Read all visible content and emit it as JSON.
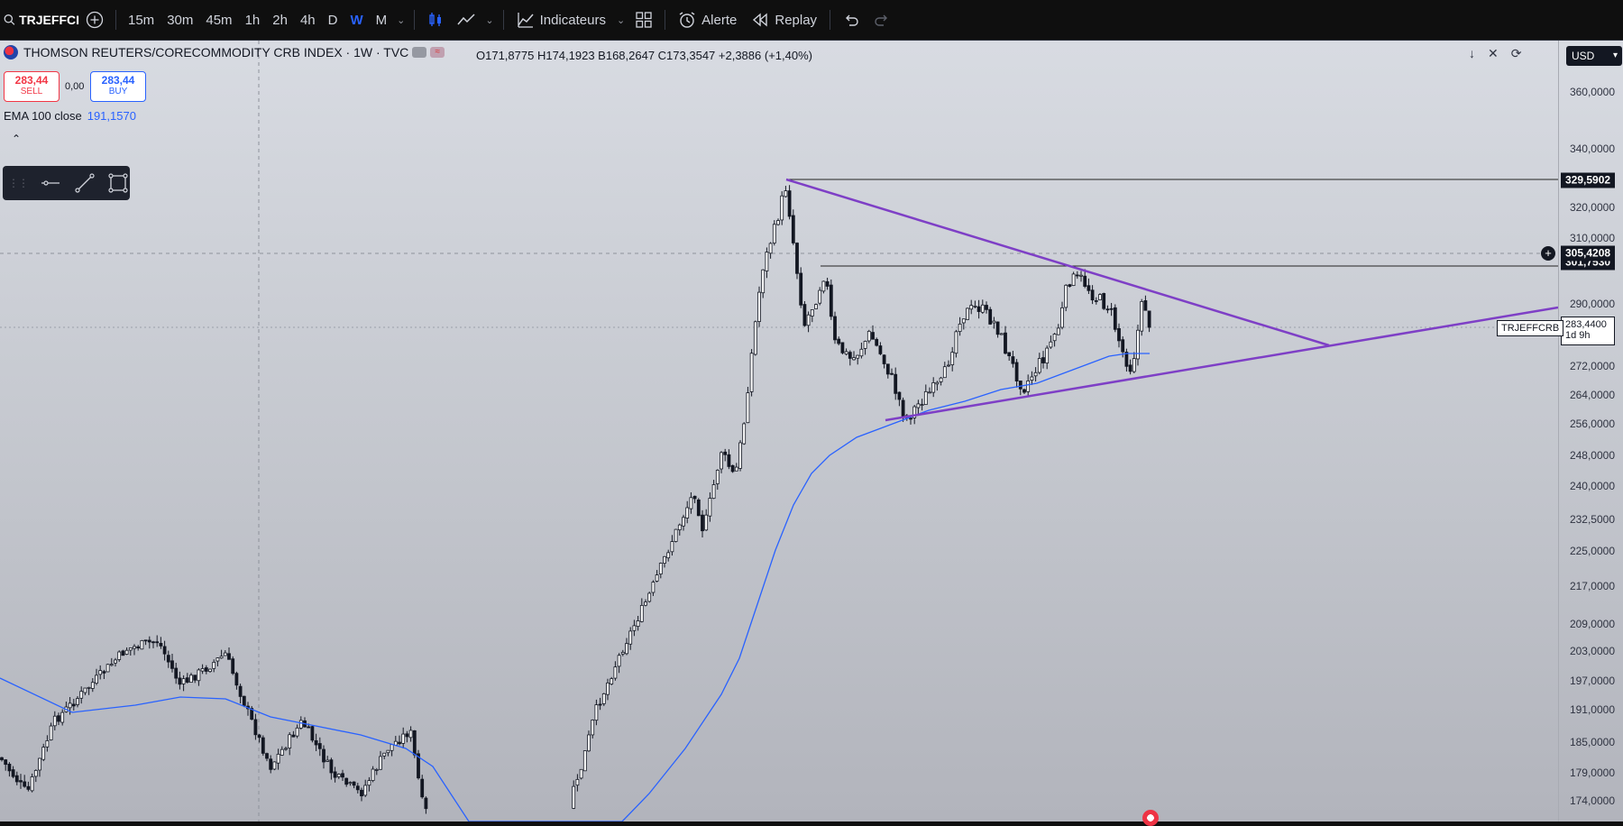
{
  "toolbar": {
    "symbol": "TRJEFFCI",
    "intervals": [
      "15m",
      "30m",
      "45m",
      "1h",
      "2h",
      "4h",
      "D",
      "W",
      "M"
    ],
    "active_interval": "W",
    "indicators_label": "Indicateurs",
    "alert_label": "Alerte",
    "replay_label": "Replay"
  },
  "legend": {
    "title": "THOMSON REUTERS/CORECOMMODITY CRB INDEX · 1W · TVC",
    "ohlc": "O171,8775 H174,1923 B168,2647 C173,3547 +2,3886 (+1,40%)"
  },
  "trade": {
    "sell_price": "283,44",
    "sell_label": "SELL",
    "spread": "0,00",
    "buy_price": "283,44",
    "buy_label": "BUY"
  },
  "ema": {
    "label": "EMA 100 close",
    "value": "191,1570"
  },
  "axis": {
    "currency": "USD",
    "ticks": [
      "360,0000",
      "340,0000",
      "320,0000",
      "310,0000",
      "290,0000",
      "272,0000",
      "264,0000",
      "256,0000",
      "248,0000",
      "240,0000",
      "232,5000",
      "225,0000",
      "217,0000",
      "209,0000",
      "203,0000",
      "197,0000",
      "191,0000",
      "185,0000",
      "179,0000",
      "174,0000"
    ],
    "tags": {
      "high_line": "329,5902",
      "crosshair": "305,4208",
      "resistance": "301,7530",
      "last_price": "283,4400",
      "countdown": "1d 9h",
      "symbol_tag": "TRJEFFCRB"
    }
  },
  "colors": {
    "candle": "#131722",
    "ema": "#2962ff",
    "trendline": "#7e3fc6",
    "sell": "#f23645",
    "buy": "#2962ff"
  },
  "icons": [
    "search-icon",
    "add-symbol-icon",
    "candles-icon",
    "line-chart-icon",
    "indicators-icon",
    "layout-icon",
    "alarm-icon",
    "replay-icon",
    "undo-icon",
    "redo-icon",
    "horizontal-line-icon",
    "trend-line-icon",
    "rectangle-icon"
  ]
}
